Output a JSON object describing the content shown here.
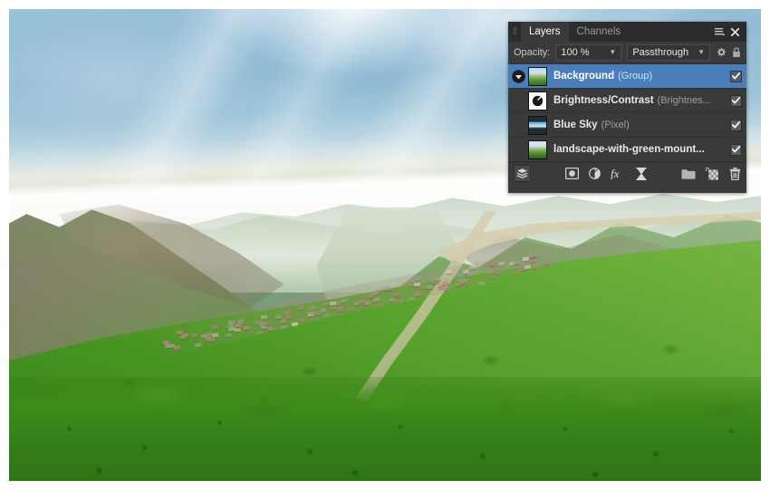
{
  "panel": {
    "grip": "⁞⁞",
    "tabs": [
      {
        "label": "Layers",
        "active": true
      },
      {
        "label": "Channels",
        "active": false
      }
    ],
    "menu_icon": "hamburger-menu-icon",
    "close_icon": "close-icon",
    "options": {
      "opacity_label": "Opacity:",
      "opacity_value": "100 %",
      "blend_mode": "Passthrough",
      "settings_icon": "gear-icon",
      "lock_icon": "lock-icon"
    },
    "layers": [
      {
        "name": "Background",
        "kind": "(Group)",
        "thumb": "group-thumbnail",
        "selected": true,
        "expanded": true,
        "indented": false,
        "visible": true
      },
      {
        "name": "Brightness/Contrast",
        "kind": "(Brightnes...",
        "thumb": "adjustment-thumbnail",
        "selected": false,
        "expanded": false,
        "indented": true,
        "visible": true
      },
      {
        "name": "Blue Sky",
        "kind": "(Pixel)",
        "thumb": "blue-sky-thumbnail",
        "selected": false,
        "expanded": false,
        "indented": true,
        "visible": true
      },
      {
        "name": "landscape-with-green-mount...",
        "kind": "",
        "thumb": "landscape-thumbnail",
        "selected": false,
        "expanded": false,
        "indented": true,
        "visible": true
      }
    ],
    "toolbar": {
      "stack_icon": "layer-stack-icon",
      "mask_icon": "add-mask-icon",
      "adjustment_icon": "add-adjustment-icon",
      "effects_icon": "layer-effects-fx-icon",
      "filter_icon": "add-live-filter-icon",
      "group_icon": "add-group-icon",
      "new_layer_icon": "add-pixel-layer-icon",
      "delete_icon": "delete-layer-icon"
    }
  },
  "colors": {
    "panel_bg": "#3a3a3a",
    "tabbar_bg": "#2c2c2c",
    "selection": "#4a7ebb",
    "text": "#e9e9e9",
    "muted_text": "#a0a0a0"
  },
  "document": {
    "image_name": "landscape-with-green-mountains"
  }
}
